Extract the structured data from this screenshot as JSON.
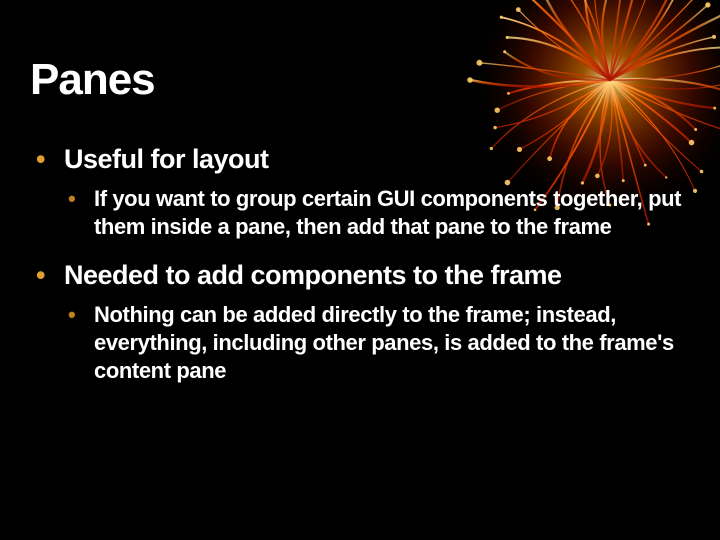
{
  "title": "Panes",
  "bullets": [
    {
      "text": "Useful for layout",
      "sub": [
        "If you want to group certain GUI components together, put them inside a pane, then add that pane to the frame"
      ]
    },
    {
      "text": "Needed to add components to the frame",
      "sub": [
        "Nothing can be added directly to the frame; instead, everything, including other panes, is added to the frame's content pane"
      ]
    }
  ]
}
